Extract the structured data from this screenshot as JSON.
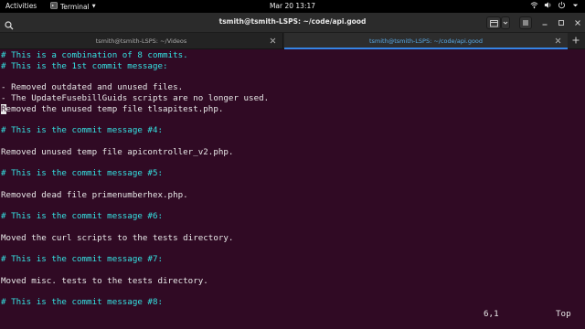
{
  "topbar": {
    "activities": "Activities",
    "app_menu": "Terminal",
    "clock": "Mar 20  13:17"
  },
  "window": {
    "title": "tsmith@tsmith-LSPS: ~/code/api.good"
  },
  "tabs": [
    {
      "label": "tsmith@tsmith-LSPS: ~/Videos",
      "active": false
    },
    {
      "label": "tsmith@tsmith-LSPS: ~/code/api.good",
      "active": true
    }
  ],
  "terminal": {
    "lines": [
      {
        "text": "# This is a combination of 8 commits.",
        "kind": "comment"
      },
      {
        "text": "# This is the 1st commit message:",
        "kind": "comment"
      },
      {
        "text": "",
        "kind": "text"
      },
      {
        "text": "- Removed outdated and unused files.",
        "kind": "text"
      },
      {
        "text": "- The UpdateFusebillGuids scripts are no longer used.",
        "kind": "text"
      },
      {
        "text": "emoved the unused temp file tlsapitest.php.",
        "kind": "text",
        "cursor_char": "R"
      },
      {
        "text": "",
        "kind": "text"
      },
      {
        "text": "# This is the commit message #4:",
        "kind": "comment"
      },
      {
        "text": "",
        "kind": "text"
      },
      {
        "text": "Removed unused temp file apicontroller_v2.php.",
        "kind": "text"
      },
      {
        "text": "",
        "kind": "text"
      },
      {
        "text": "# This is the commit message #5:",
        "kind": "comment"
      },
      {
        "text": "",
        "kind": "text"
      },
      {
        "text": "Removed dead file primenumberhex.php.",
        "kind": "text"
      },
      {
        "text": "",
        "kind": "text"
      },
      {
        "text": "# This is the commit message #6:",
        "kind": "comment"
      },
      {
        "text": "",
        "kind": "text"
      },
      {
        "text": "Moved the curl scripts to the tests directory.",
        "kind": "text"
      },
      {
        "text": "",
        "kind": "text"
      },
      {
        "text": "# This is the commit message #7:",
        "kind": "comment"
      },
      {
        "text": "",
        "kind": "text"
      },
      {
        "text": "Moved misc. tests to the tests directory.",
        "kind": "text"
      },
      {
        "text": "",
        "kind": "text"
      },
      {
        "text": "# This is the commit message #8:",
        "kind": "comment"
      }
    ],
    "status_position": "6,1",
    "status_scroll": "Top"
  },
  "colors": {
    "terminal_bg": "#300a24",
    "comment": "#34e2e2",
    "text": "#e8e8e8",
    "tab_active": "#58a9e6"
  }
}
